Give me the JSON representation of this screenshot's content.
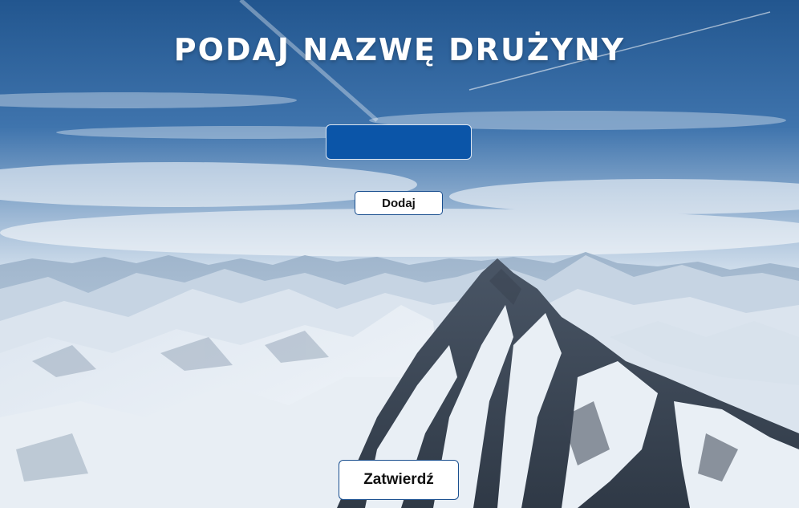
{
  "page": {
    "title": "PODAJ NAZWĘ DRUŻYNY"
  },
  "team_input": {
    "value": "",
    "placeholder": ""
  },
  "buttons": {
    "add_label": "Dodaj",
    "confirm_label": "Zatwierdź"
  },
  "background": {
    "description_icon": "mountain-landscape-image"
  },
  "colors": {
    "input_background": "#0b55a8",
    "sky_top": "#245a93",
    "snow": "#eef2f6"
  }
}
